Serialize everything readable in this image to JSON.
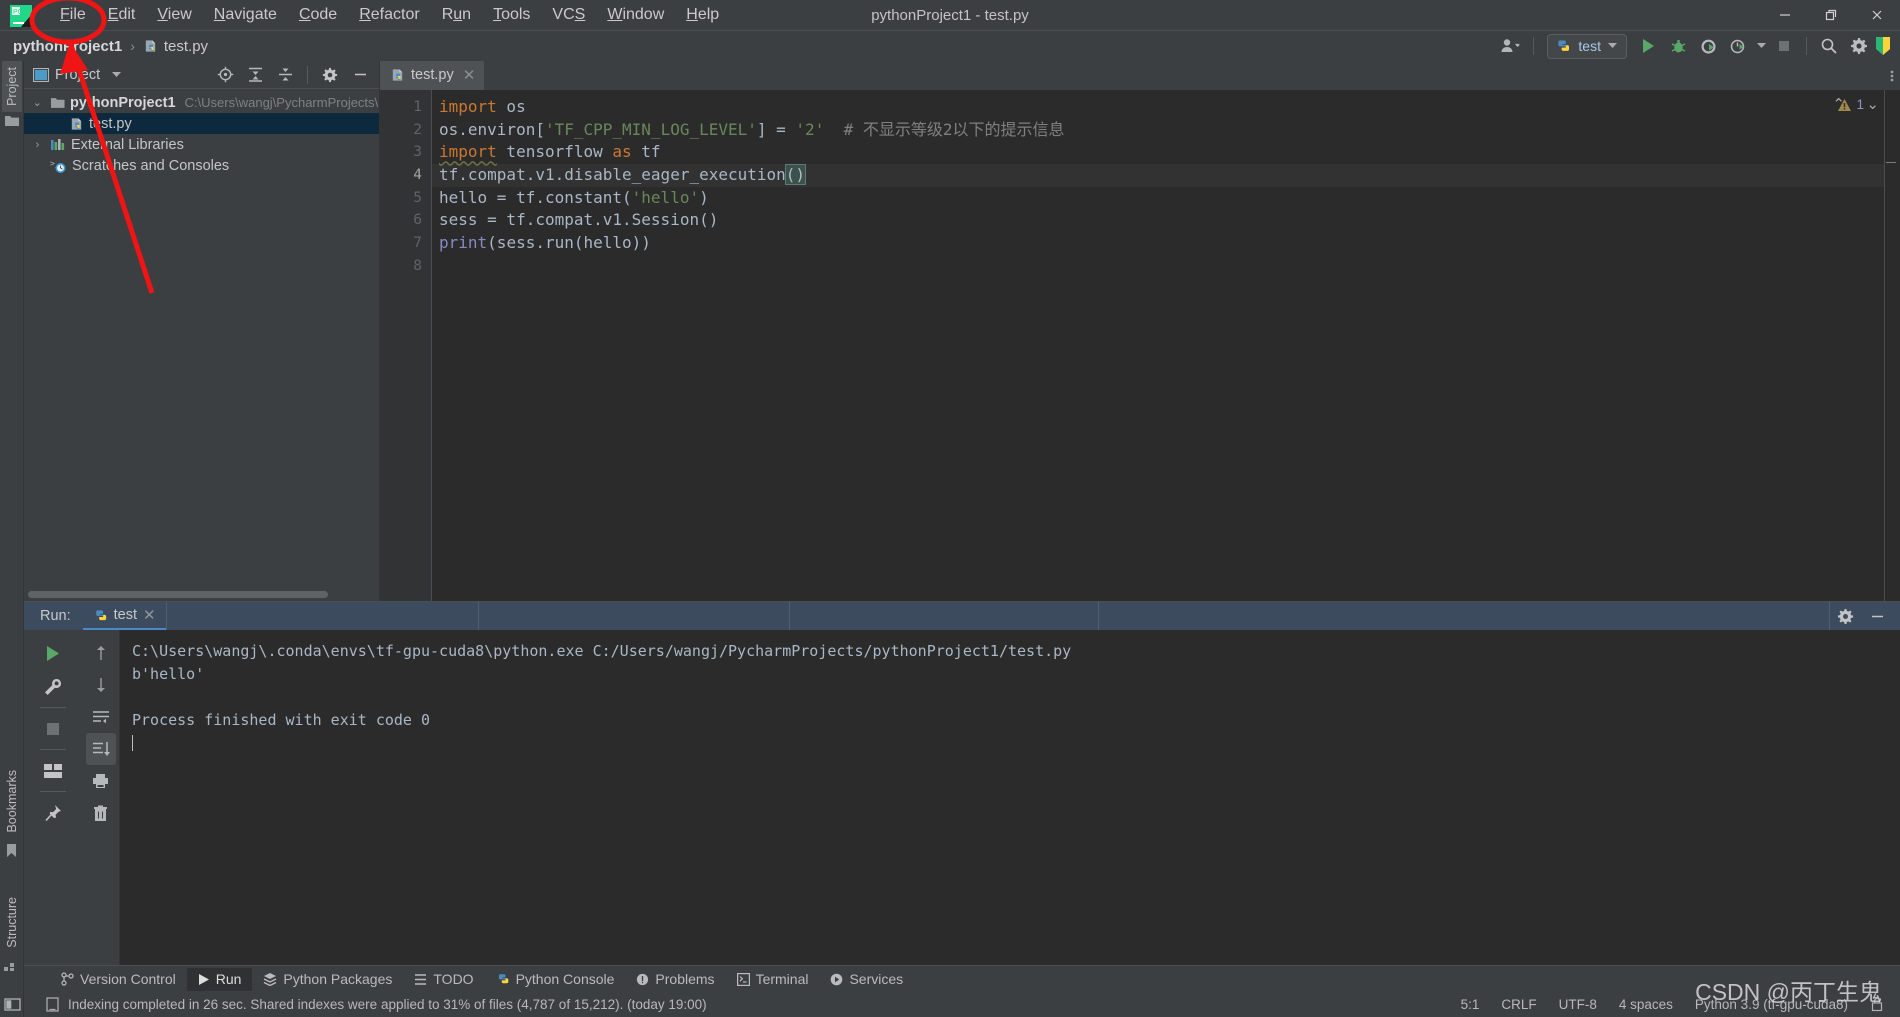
{
  "window": {
    "title": "pythonProject1 - test.py",
    "minimize": "—",
    "restore": "❐",
    "close": "✕"
  },
  "menubar": {
    "items": [
      {
        "label": "File",
        "mnemonic": "F"
      },
      {
        "label": "Edit",
        "mnemonic": "E"
      },
      {
        "label": "View",
        "mnemonic": "V"
      },
      {
        "label": "Navigate",
        "mnemonic": "N"
      },
      {
        "label": "Code",
        "mnemonic": "C"
      },
      {
        "label": "Refactor",
        "mnemonic": "R"
      },
      {
        "label": "Run",
        "mnemonic": "u"
      },
      {
        "label": "Tools",
        "mnemonic": "T"
      },
      {
        "label": "VCS",
        "mnemonic": "S"
      },
      {
        "label": "Window",
        "mnemonic": "W"
      },
      {
        "label": "Help",
        "mnemonic": "H"
      }
    ]
  },
  "navbar": {
    "breadcrumb": [
      "pythonProject1",
      "test.py"
    ],
    "separator": "›",
    "run_config": "test",
    "icons": [
      "account-icon",
      "run-icon",
      "debug-icon",
      "run-coverage-icon",
      "profile-icon",
      "stop-icon",
      "search-icon",
      "settings-icon"
    ]
  },
  "project_panel": {
    "title": "Project",
    "tree": [
      {
        "name": "pythonProject1",
        "path": "C:\\Users\\wangj\\PycharmProjects\\p",
        "type": "folder",
        "expanded": true,
        "bold": true,
        "selected": false
      },
      {
        "name": "test.py",
        "path": "",
        "type": "python-file",
        "expanded": false,
        "bold": false,
        "selected": true
      },
      {
        "name": "External Libraries",
        "path": "",
        "type": "library",
        "expanded": false,
        "bold": false,
        "selected": false
      },
      {
        "name": "Scratches and Consoles",
        "path": "",
        "type": "scratch",
        "expanded": false,
        "bold": false,
        "selected": false
      }
    ]
  },
  "left_rail": {
    "tabs": [
      "Project",
      "Bookmarks",
      "Structure"
    ]
  },
  "editor": {
    "tab_name": "test.py",
    "warning_count": "1",
    "lines": [
      "1",
      "2",
      "3",
      "4",
      "5",
      "6",
      "7",
      "8"
    ],
    "current_line": 4,
    "code": [
      {
        "n": 1,
        "tokens": [
          {
            "t": "import",
            "c": "k"
          },
          {
            "t": " os",
            "c": "n"
          }
        ]
      },
      {
        "n": 2,
        "tokens": [
          {
            "t": "os.environ[",
            "c": "n"
          },
          {
            "t": "'TF_CPP_MIN_LOG_LEVEL'",
            "c": "s"
          },
          {
            "t": "] = ",
            "c": "n"
          },
          {
            "t": "'2'",
            "c": "s"
          },
          {
            "t": "  # 不显示等级2以下的提示信息",
            "c": "c"
          }
        ]
      },
      {
        "n": 3,
        "tokens": [
          {
            "t": "import",
            "c": "k squig"
          },
          {
            "t": " tensorflow ",
            "c": "n"
          },
          {
            "t": "as",
            "c": "k"
          },
          {
            "t": " tf",
            "c": "n"
          }
        ]
      },
      {
        "n": 4,
        "tokens": [
          {
            "t": "tf.compat.v1.disable_eager_execution",
            "c": "n"
          },
          {
            "t": "()",
            "c": "brmatch"
          }
        ]
      },
      {
        "n": 5,
        "tokens": [
          {
            "t": "hello = tf.constant(",
            "c": "n"
          },
          {
            "t": "'hello'",
            "c": "s"
          },
          {
            "t": ")",
            "c": "n"
          }
        ]
      },
      {
        "n": 6,
        "tokens": [
          {
            "t": "sess = tf.compat.v1.Session()",
            "c": "n"
          }
        ]
      },
      {
        "n": 7,
        "tokens": [
          {
            "t": "print",
            "c": "b"
          },
          {
            "t": "(sess.run(hello))",
            "c": "n"
          }
        ]
      },
      {
        "n": 8,
        "tokens": []
      }
    ]
  },
  "run_panel": {
    "label": "Run:",
    "tab_name": "test",
    "console": [
      "C:\\Users\\wangj\\.conda\\envs\\tf-gpu-cuda8\\python.exe C:/Users/wangj/PycharmProjects/pythonProject1/test.py",
      "b'hello'",
      "",
      "Process finished with exit code 0"
    ],
    "rail_icons": [
      "rerun-icon",
      "wrench-icon",
      "stop-icon",
      "layout-icon",
      "pin-icon"
    ],
    "rail2_icons": [
      "arrow-up-icon",
      "arrow-down-icon",
      "soft-wrap-icon",
      "scroll-to-end-icon",
      "print-icon",
      "trash-icon"
    ]
  },
  "bottom_tabs": {
    "items": [
      {
        "label": "Version Control",
        "icon": "branch-icon",
        "active": false
      },
      {
        "label": "Run",
        "icon": "play-icon",
        "active": true
      },
      {
        "label": "Python Packages",
        "icon": "packages-icon",
        "active": false
      },
      {
        "label": "TODO",
        "icon": "todo-icon",
        "active": false
      },
      {
        "label": "Python Console",
        "icon": "python-icon",
        "active": false
      },
      {
        "label": "Problems",
        "icon": "problems-icon",
        "active": false
      },
      {
        "label": "Terminal",
        "icon": "terminal-icon",
        "active": false
      },
      {
        "label": "Services",
        "icon": "services-icon",
        "active": false
      }
    ]
  },
  "statusbar": {
    "message": "Indexing completed in 26 sec. Shared indexes were applied to 31% of files (4,787 of 15,212). (today 19:00)",
    "caret": "5:1",
    "line_sep": "CRLF",
    "encoding": "UTF-8",
    "indent": "4 spaces",
    "interpreter": "Python 3.9 (tf-gpu-cuda8)",
    "watermark": "CSDN @丙丁生鬼"
  },
  "colors": {
    "accent_blue": "#4a88c7",
    "green_run": "#59a869",
    "annotation_red": "#f01414",
    "editor_bg": "#2b2b2b",
    "panel_bg": "#3c3f41"
  }
}
